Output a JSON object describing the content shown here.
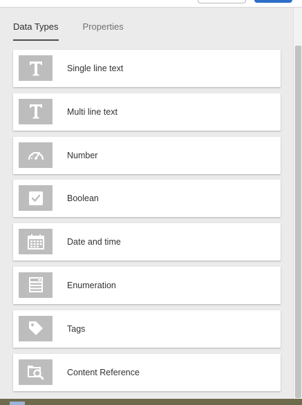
{
  "tabs": [
    {
      "label": "Data Types",
      "active": true
    },
    {
      "label": "Properties",
      "active": false
    }
  ],
  "data_types": [
    {
      "label": "Single line text",
      "icon": "text-t-icon"
    },
    {
      "label": "Multi line text",
      "icon": "text-t-icon"
    },
    {
      "label": "Number",
      "icon": "gauge-icon"
    },
    {
      "label": "Boolean",
      "icon": "checkbox-icon"
    },
    {
      "label": "Date and time",
      "icon": "calendar-icon"
    },
    {
      "label": "Enumeration",
      "icon": "list-enumeration-icon"
    },
    {
      "label": "Tags",
      "icon": "tag-icon"
    },
    {
      "label": "Content Reference",
      "icon": "folder-search-icon"
    }
  ],
  "colors": {
    "icon_bg": "#bdbdbd",
    "primary_button": "#2d6ec9"
  }
}
